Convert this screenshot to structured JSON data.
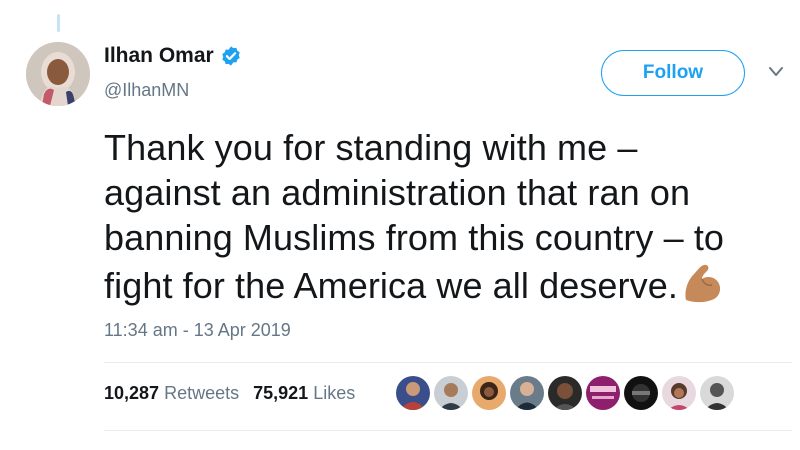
{
  "author": {
    "name": "Ilhan Omar",
    "handle": "@IlhanMN",
    "verified": true
  },
  "follow_button": {
    "label": "Follow"
  },
  "tweet": {
    "lines": [
      "Thank you for standing with me –",
      "against an administration that ran on",
      "banning Muslims from this country – to",
      "fight for the America we all deserve."
    ],
    "emoji": "flexed-biceps-emoji",
    "timestamp": "11:34 am - 13 Apr 2019"
  },
  "stats": {
    "retweets_count": "10,287",
    "retweets_label": "Retweets",
    "likes_count": "75,921",
    "likes_label": "Likes"
  },
  "liker_avatars": [
    "avatar-1",
    "avatar-2",
    "avatar-3",
    "avatar-4",
    "avatar-5",
    "avatar-6",
    "avatar-7",
    "avatar-8",
    "avatar-9"
  ],
  "colors": {
    "accent": "#1da1f2",
    "text": "#14171a",
    "secondary": "#657786",
    "divider": "#e6ecf0"
  }
}
